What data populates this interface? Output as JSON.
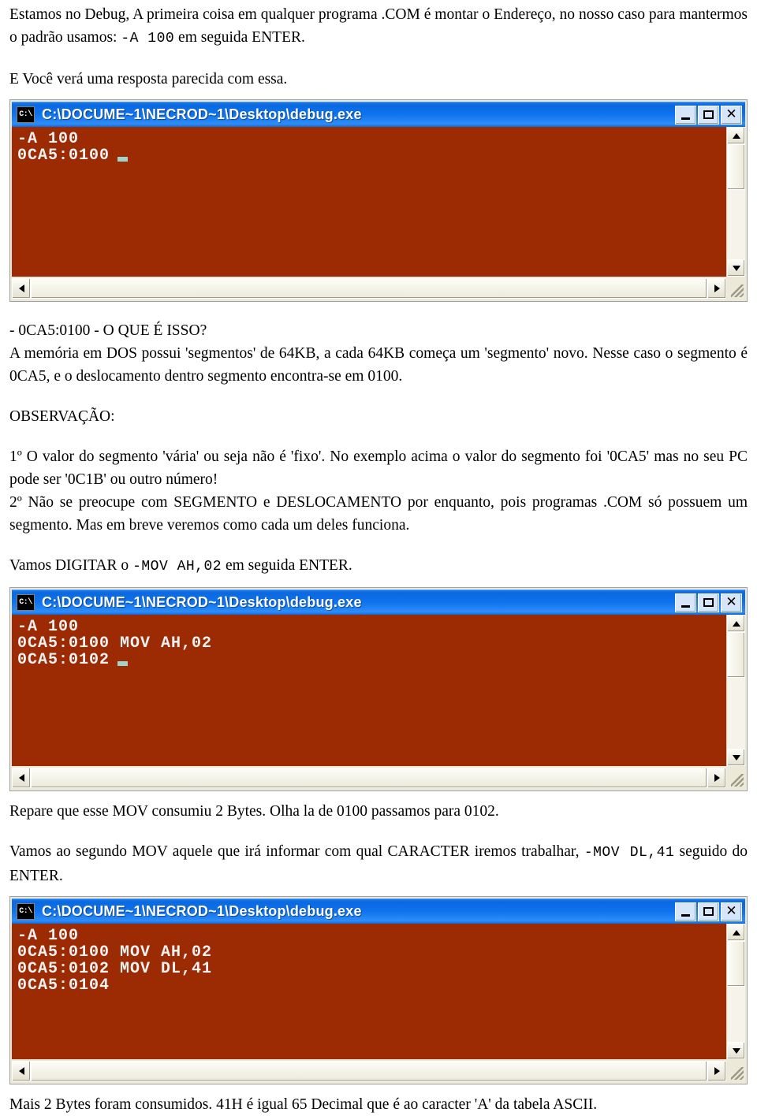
{
  "document": {
    "paragraphs": {
      "intro_1a": "Estamos no Debug, A primeira coisa em qualquer programa .COM é montar o Endereço, no nosso caso para mantermos o padrão usamos: ",
      "intro_1_mono": "-A 100",
      "intro_1b": " em seguida ENTER.",
      "intro_2": "E Você verá uma resposta parecida com essa.",
      "q_heading": "- 0CA5:0100 - O QUE É ISSO?",
      "mem_explain": "A memória em DOS possui 'segmentos' de 64KB, a cada 64KB começa um 'segmento' novo. Nesse caso o segmento é 0CA5, e o deslocamento dentro segmento encontra-se em 0100.",
      "observation_label": "OBSERVAÇÃO:",
      "note_1": "1º O valor do segmento 'vária' ou seja não é 'fixo'. No exemplo acima o valor do segmento foi '0CA5' mas no seu PC pode ser '0C1B' ou outro número!",
      "note_2": "2º Não se preocupe com SEGMENTO e DESLOCAMENTO por enquanto, pois programas .COM só possuem um segmento. Mas em breve veremos como cada um deles funciona.",
      "digit_mov_a": "Vamos DIGITAR o ",
      "digit_mov_mono": "-MOV AH,02",
      "digit_mov_b": " em seguida ENTER.",
      "bytes_note": "Repare que esse MOV consumiu 2 Bytes. Olha la de 0100 passamos para 0102.",
      "second_mov_a": "Vamos ao segundo MOV aquele que irá informar com qual CARACTER iremos trabalhar, ",
      "second_mov_mono": "-MOV DL,41",
      "second_mov_b": " seguido do ENTER.",
      "ascii_note": "Mais 2 Bytes foram consumidos. 41H é igual 65 Decimal que é ao caracter 'A' da tabela ASCII."
    }
  },
  "console_common": {
    "title": "C:\\DOCUME~1\\NECROD~1\\Desktop\\debug.exe",
    "icon_label": "C:\\",
    "minimize_label": "Minimizar",
    "maximize_label": "Maximizar",
    "close_label": "Fechar",
    "close_glyph": "✕",
    "colors": {
      "titlebar": "#0f72ee",
      "screen_background": "#9c2a02",
      "screen_text": "#f2f2f2",
      "window_chrome": "#ece9d8",
      "cursor": "#9fd4cc"
    }
  },
  "consoles": [
    {
      "id": "console-1",
      "lines": [
        "-A 100",
        "0CA5:0100"
      ],
      "cursor_on_last_line": true
    },
    {
      "id": "console-2",
      "lines": [
        "-A 100",
        "0CA5:0100 MOV AH,02",
        "0CA5:0102"
      ],
      "cursor_on_last_line": true
    },
    {
      "id": "console-3",
      "lines": [
        "-A 100",
        "0CA5:0100 MOV AH,02",
        "0CA5:0102 MOV DL,41",
        "0CA5:0104"
      ],
      "cursor_on_last_line": false
    }
  ]
}
